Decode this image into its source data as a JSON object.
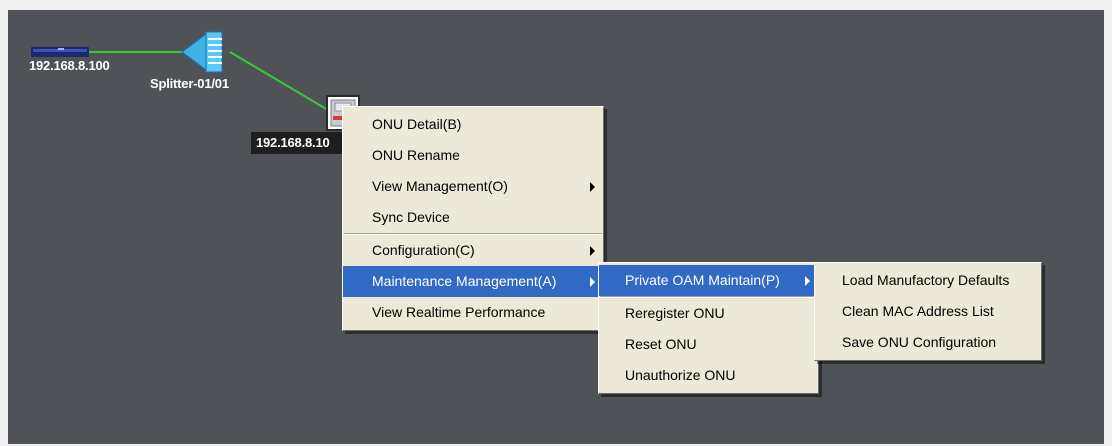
{
  "topology": {
    "olt_label": "192.168.8.100",
    "splitter_label": "Splitter-01/01",
    "onu_label": "192.168.8.10",
    "link_color": "#3dc43d",
    "canvas_color": "#4f5256"
  },
  "context_menu": {
    "items": [
      {
        "label": "ONU Detail(B)"
      },
      {
        "label": "ONU Rename"
      },
      {
        "label": "View Management(O)"
      },
      {
        "label": "Sync Device"
      },
      {
        "label": "Configuration(C)"
      },
      {
        "label": "Maintenance Management(A)"
      },
      {
        "label": "View Realtime Performance"
      }
    ]
  },
  "maintenance_submenu": {
    "items": [
      {
        "label": "Private OAM Maintain(P)"
      },
      {
        "label": "Reregister ONU"
      },
      {
        "label": "Reset ONU"
      },
      {
        "label": "Unauthorize ONU"
      }
    ]
  },
  "oam_submenu": {
    "items": [
      {
        "label": "Load Manufactory Defaults"
      },
      {
        "label": "Clean MAC Address List"
      },
      {
        "label": "Save ONU Configuration"
      }
    ]
  },
  "colors": {
    "menu_bg": "#ece9d8",
    "selection": "#316ac5"
  }
}
